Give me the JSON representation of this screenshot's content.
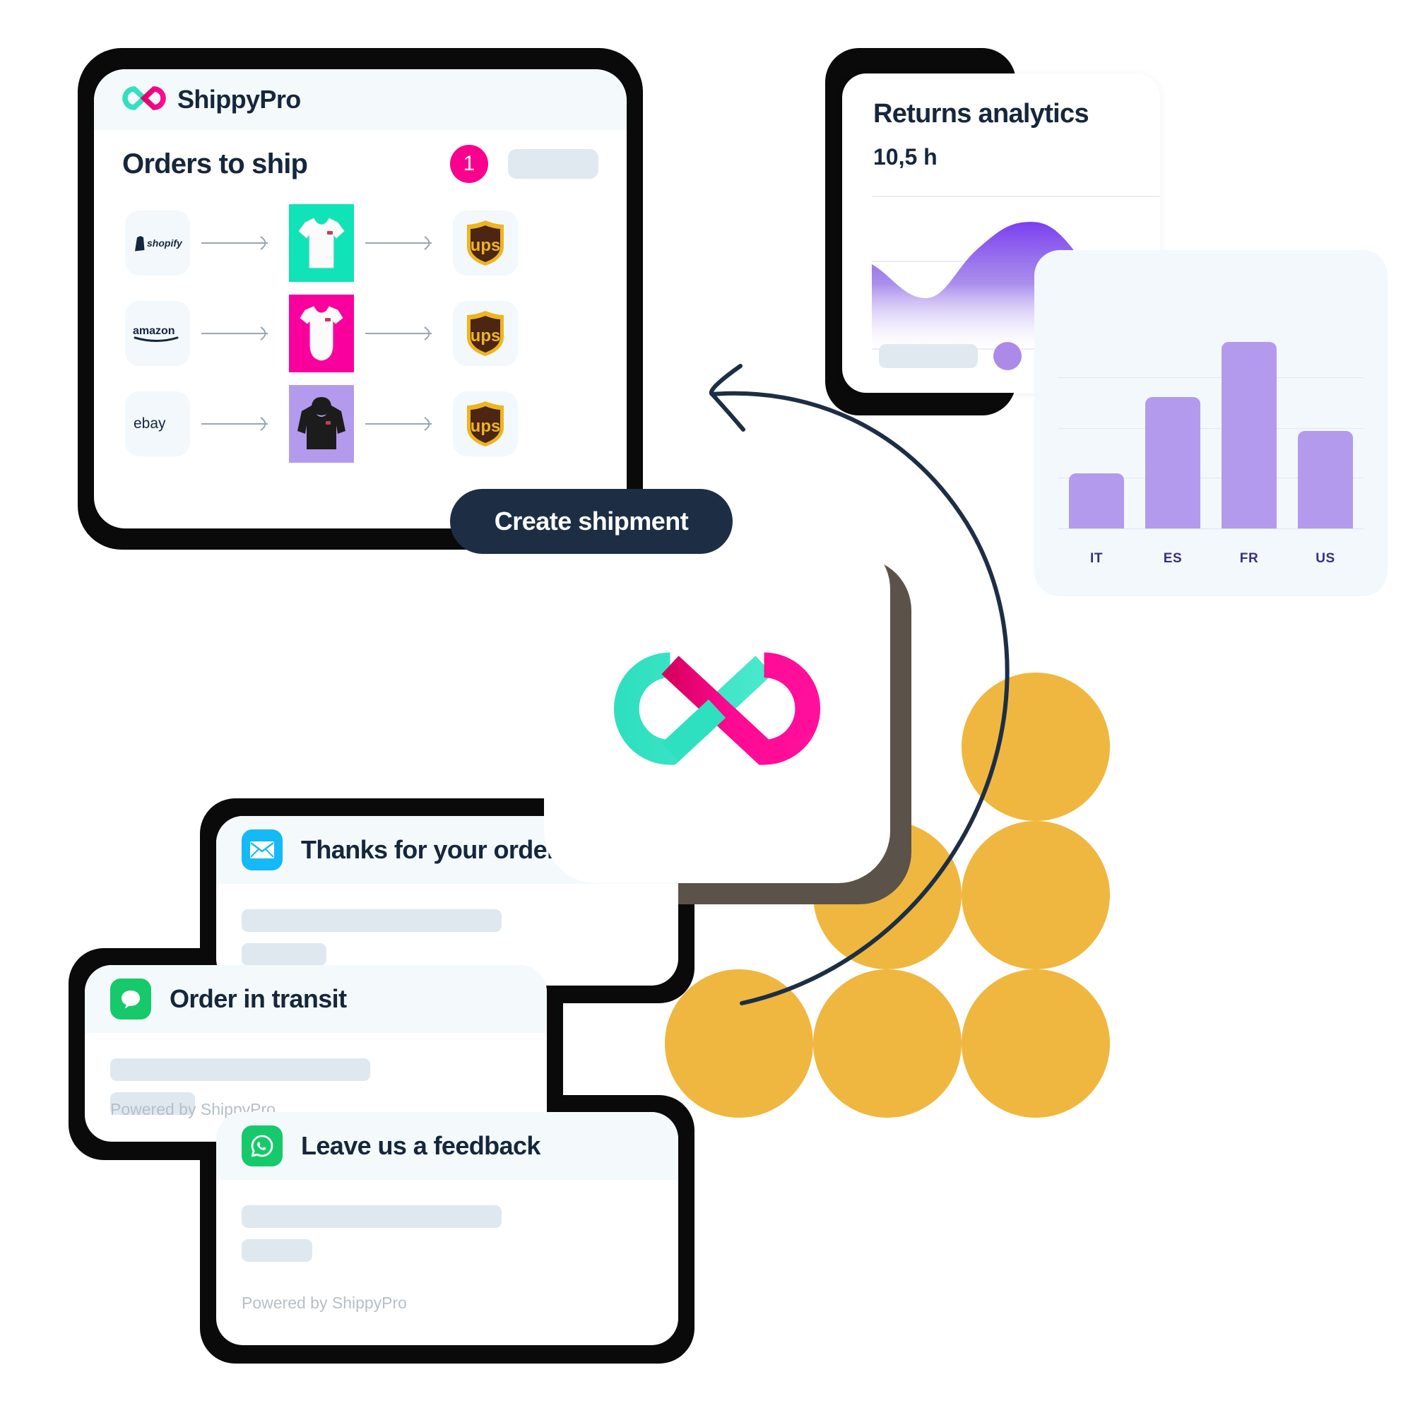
{
  "brand": {
    "name": "ShippyPro",
    "logo_icon": "shippypro-infinity-logo",
    "teal": "#2fe0c0",
    "pink": "#f9008e",
    "ink": "#16263c"
  },
  "orders_card": {
    "title": "Orders to ship",
    "badge_count": "1",
    "ghost_bar": "",
    "rows": [
      {
        "marketplace": "shopify",
        "marketplace_label": "shopify",
        "product_icon": "tshirt-white",
        "product_bg": "#0fe3b7",
        "carrier": "ups",
        "carrier_label": "ups"
      },
      {
        "marketplace": "amazon",
        "marketplace_label": "amazon",
        "product_icon": "onesie-white",
        "product_bg": "#f9009e",
        "carrier": "ups",
        "carrier_label": "ups"
      },
      {
        "marketplace": "ebay",
        "marketplace_label": "ebay",
        "product_icon": "hoodie-black",
        "product_bg": "#b49aec",
        "carrier": "ups",
        "carrier_label": "ups"
      }
    ]
  },
  "create_shipment": {
    "label": "Create shipment"
  },
  "logo_card": {
    "icon": "shippypro-infinity-logo"
  },
  "returns_card": {
    "title": "Returns analytics",
    "value": "10,5 h",
    "ghost_bar": "",
    "dot_color": "#ab8ae8"
  },
  "notifications": [
    {
      "icon": "email-icon",
      "icon_color": "#14b9f5",
      "title": "Thanks for your order",
      "footer": ""
    },
    {
      "icon": "sms-icon",
      "icon_color": "#16c96a",
      "title": "Order in transit",
      "footer": "Powered by ShippyPro"
    },
    {
      "icon": "whatsapp-icon",
      "icon_color": "#16c96a",
      "title": "Leave us a feedback",
      "footer": "Powered by ShippyPro"
    }
  ],
  "decoration": {
    "dots_color": "#efb73f",
    "dots": [
      {
        "cx": 1466,
        "cy": 1057,
        "r": 105
      },
      {
        "cx": 1256,
        "cy": 1267,
        "r": 105
      },
      {
        "cx": 1466,
        "cy": 1267,
        "r": 105
      },
      {
        "cx": 1046,
        "cy": 1477,
        "r": 105
      },
      {
        "cx": 1256,
        "cy": 1477,
        "r": 105
      },
      {
        "cx": 1466,
        "cy": 1477,
        "r": 105
      }
    ],
    "arrow": "curved-flow-arrow"
  },
  "chart_data": [
    {
      "type": "area",
      "title": "Returns analytics",
      "subtitle": "10,5 h",
      "x": [
        0,
        1,
        2,
        3,
        4,
        5,
        6,
        7,
        8,
        9,
        10
      ],
      "values": [
        62,
        52,
        40,
        38,
        52,
        76,
        88,
        90,
        80,
        58,
        44
      ],
      "xlabel": "",
      "ylabel": "",
      "ylim": [
        0,
        100
      ],
      "grid": true,
      "gridlines": 3,
      "legend": "none",
      "fill": "linear-gradient #7b3ff0 -> #ffffff",
      "color": "#7b4ae2"
    },
    {
      "type": "bar",
      "title": "",
      "categories": [
        "IT",
        "ES",
        "FR",
        "US"
      ],
      "values": [
        26,
        62,
        88,
        46
      ],
      "xlabel": "",
      "ylabel": "",
      "ylim": [
        0,
        100
      ],
      "grid": true,
      "gridlines": 3,
      "legend": "none",
      "color": "#b49aec"
    }
  ]
}
